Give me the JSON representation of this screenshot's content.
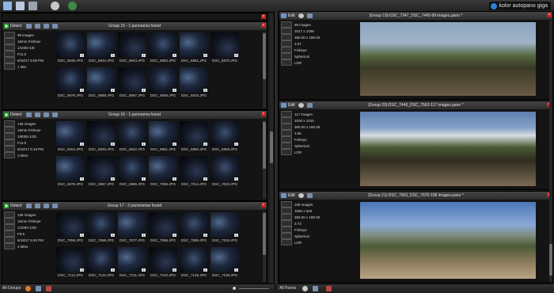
{
  "app": {
    "brand": "kolor autopano giga",
    "toolbar_icons": [
      "folder-icon",
      "images-icon",
      "panorama-icon",
      "settings-gear-icon",
      "globe-icon"
    ]
  },
  "colors": {
    "accent_green": "#2aa838",
    "close_red": "#c21e1e",
    "brand_blue": "#2b7fd6"
  },
  "groups": [
    {
      "detect_label": "Detect",
      "title": "Group 15 - 1 panorama found",
      "info": [
        {
          "icon": "images-icon",
          "value": "99 images"
        },
        {
          "icon": "lens-icon",
          "value": "16mm Fisheye"
        },
        {
          "icon": "shutter-icon",
          "value": "1/1000-1/8"
        },
        {
          "icon": "aperture-icon",
          "value": "F11.0"
        },
        {
          "icon": "date-icon",
          "value": "6/18/17 5:08 PM"
        },
        {
          "icon": "duration-icon",
          "value": "1 Min"
        }
      ],
      "thumbs": [
        {
          "name": "DSC_6835.JPG",
          "n": "1"
        },
        {
          "name": "DSC_6834.JPG",
          "n": "1"
        },
        {
          "name": "DSC_6843.JPG",
          "n": "1"
        },
        {
          "name": "DSC_6852.JPG",
          "n": "1"
        },
        {
          "name": "DSC_6861.JPG",
          "n": "1"
        },
        {
          "name": "DSC_6870.JPG",
          "n": "1"
        },
        {
          "name": "DSC_6879.JPG",
          "n": "1"
        },
        {
          "name": "DSC_6888.JPG",
          "n": "1"
        },
        {
          "name": "DSC_6897.JPG",
          "n": "1"
        },
        {
          "name": "DSC_6906.JPG",
          "n": "1"
        },
        {
          "name": "DSC_6915.JPG",
          "n": "1"
        }
      ]
    },
    {
      "detect_label": "Detect",
      "title": "Group 16 - 1 panorama found",
      "info": [
        {
          "icon": "images-icon",
          "value": "136 images"
        },
        {
          "icon": "lens-icon",
          "value": "16mm Fisheye"
        },
        {
          "icon": "shutter-icon",
          "value": "1/8000-1/20"
        },
        {
          "icon": "aperture-icon",
          "value": "F11.0"
        },
        {
          "icon": "date-icon",
          "value": "6/18/17 5:18 PM"
        },
        {
          "icon": "duration-icon",
          "value": "3 Mins"
        }
      ],
      "thumbs": [
        {
          "name": "DSC_6924.JPG",
          "n": "1"
        },
        {
          "name": "DSC_6933.JPG",
          "n": "1"
        },
        {
          "name": "DSC_6942.JPG",
          "n": "1"
        },
        {
          "name": "DSC_6951.JPG",
          "n": "1"
        },
        {
          "name": "DSC_6960.JPG",
          "n": "1"
        },
        {
          "name": "DSC_6969.JPG",
          "n": "1"
        },
        {
          "name": "DSC_6978.JPG",
          "n": "1"
        },
        {
          "name": "DSC_6987.JPG",
          "n": "1"
        },
        {
          "name": "DSC_6996.JPG",
          "n": "1"
        },
        {
          "name": "DSC_7005.JPG",
          "n": "1"
        },
        {
          "name": "DSC_7014.JPG",
          "n": "1"
        },
        {
          "name": "DSC_7023.JPG",
          "n": "1"
        }
      ]
    },
    {
      "detect_label": "Detect",
      "title": "Group 17 - 2 panoramas found",
      "info": [
        {
          "icon": "images-icon",
          "value": "136 images"
        },
        {
          "icon": "lens-icon",
          "value": "16mm Fisheye"
        },
        {
          "icon": "shutter-icon",
          "value": "1/1000-1/30"
        },
        {
          "icon": "aperture-icon",
          "value": "F9.5"
        },
        {
          "icon": "date-icon",
          "value": "6/18/17 5:40 PM"
        },
        {
          "icon": "duration-icon",
          "value": "3 Mins"
        }
      ],
      "thumbs": [
        {
          "name": "DSC_7059.JPG",
          "n": "1"
        },
        {
          "name": "DSC_7068.JPG",
          "n": "1"
        },
        {
          "name": "DSC_7077.JPG",
          "n": "1"
        },
        {
          "name": "DSC_7086.JPG",
          "n": "1"
        },
        {
          "name": "DSC_7095.JPG",
          "n": "1"
        },
        {
          "name": "DSC_7104.JPG",
          "n": "1"
        },
        {
          "name": "DSC_7113.JPG",
          "n": "1"
        },
        {
          "name": "DSC_7122.JPG",
          "n": "1"
        },
        {
          "name": "DSC_7131.JPG",
          "n": "1"
        },
        {
          "name": "DSC_7140.JPG",
          "n": "1"
        },
        {
          "name": "DSC_7149.JPG",
          "n": "1"
        },
        {
          "name": "DSC_7158.JPG",
          "n": "1"
        }
      ]
    }
  ],
  "panos": [
    {
      "edit_label": "Edit",
      "title": "[Group 19]-DSC_7347_DSC_7445-99 images.pano *",
      "info": [
        {
          "icon": "images-icon",
          "value": "99 images"
        },
        {
          "icon": "size-icon",
          "value": "2017 x 1008"
        },
        {
          "icon": "fov-icon",
          "value": "360.00 x 180.00"
        },
        {
          "icon": "rms-icon",
          "value": "2.67"
        },
        {
          "icon": "projection-icon",
          "value": "Fisheye"
        },
        {
          "icon": "projection-out-icon",
          "value": "Spherical"
        },
        {
          "icon": "ldr-icon",
          "value": "LDR"
        }
      ]
    },
    {
      "edit_label": "Edit",
      "title": "[Group 20]-DSC_7446_DSC_7562-117 images.pano *",
      "info": [
        {
          "icon": "images-icon",
          "value": "117 images"
        },
        {
          "icon": "size-icon",
          "value": "2020 x 1010"
        },
        {
          "icon": "fov-icon",
          "value": "360.00 x 180.00"
        },
        {
          "icon": "rms-icon",
          "value": "3.66"
        },
        {
          "icon": "projection-icon",
          "value": "Fisheye"
        },
        {
          "icon": "projection-out-icon",
          "value": "Spherical"
        },
        {
          "icon": "ldr-icon",
          "value": "LDR"
        }
      ]
    },
    {
      "edit_label": "Edit",
      "title": "[Group 21]-DSC_7563_DSC_7670-108 images.pano *",
      "info": [
        {
          "icon": "images-icon",
          "value": "108 images"
        },
        {
          "icon": "size-icon",
          "value": "1680 x 840"
        },
        {
          "icon": "fov-icon",
          "value": "360.00 x 180.00"
        },
        {
          "icon": "rms-icon",
          "value": "3.73"
        },
        {
          "icon": "projection-icon",
          "value": "Fisheye"
        },
        {
          "icon": "projection-out-icon",
          "value": "Spherical"
        },
        {
          "icon": "ldr-icon",
          "value": "LDR"
        }
      ]
    }
  ],
  "status": {
    "left_label": "All Groups",
    "right_label": "All Panos"
  }
}
